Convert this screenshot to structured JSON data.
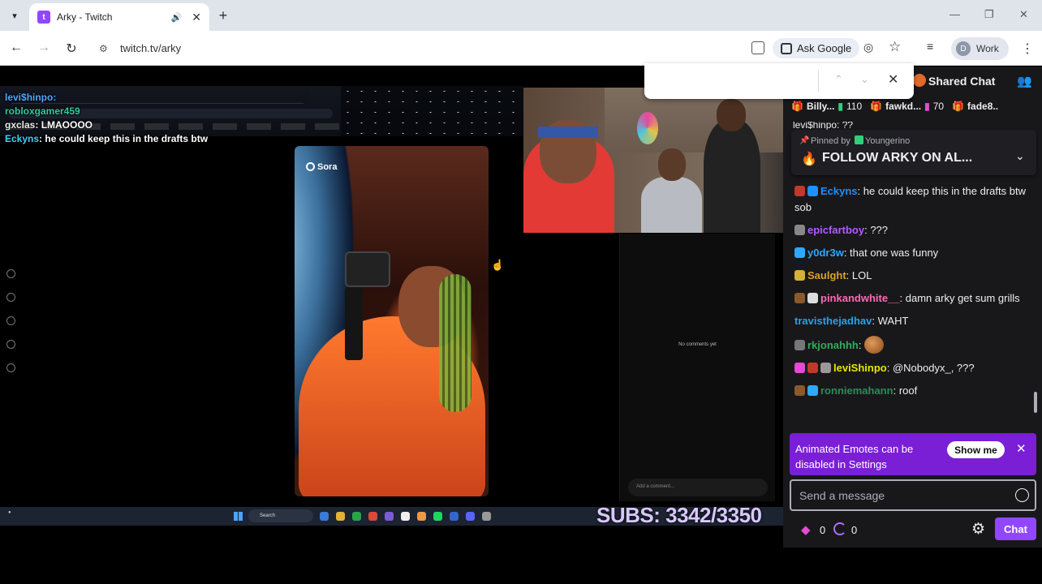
{
  "browser": {
    "tab_title": "Arky - Twitch",
    "url": "twitch.tv/arky",
    "ask_google": "Ask Google",
    "profile_initial": "D",
    "profile_name": "Work"
  },
  "stream": {
    "overlay_chat": [
      {
        "user": "levi$hinpo:",
        "text": ""
      },
      {
        "user": "robloxgamer459",
        "text": ""
      },
      {
        "user": "gxclas",
        "text": ": LMAOOOO"
      },
      {
        "user": "Eckyns",
        "text": ": he could keep this in the drafts btw"
      }
    ],
    "sora_label": "Sora",
    "no_comments": "No comments yet",
    "add_comment": "Add a comment...",
    "taskbar_search": "Search",
    "subs_text": "SUBS: 3342/3350"
  },
  "chat": {
    "shared_chat_label": "Shared Chat",
    "leaderboard": [
      {
        "name": "Billy...",
        "count": "110"
      },
      {
        "name": "fawkd...",
        "count": "70"
      },
      {
        "name": "fade8..",
        "count": ""
      }
    ],
    "top_clip": "levi$hinpo: ??",
    "pinned": {
      "by_prefix": "Pinned by",
      "by_user": "Youngerino",
      "message": "FOLLOW ARKY ON AL..."
    },
    "messages": [
      {
        "user": "Eckyns",
        "sep": ":",
        "text": " he could keep this in the drafts btw sob"
      },
      {
        "user": "epicfartboy",
        "sep": ":",
        "text": " ???"
      },
      {
        "user": "y0dr3w",
        "sep": ":",
        "text": " that one was funny"
      },
      {
        "user": "Saulght",
        "sep": ":",
        "text": " LOL"
      },
      {
        "user": "pinkandwhite__",
        "sep": ":",
        "text": " damn arky get sum grills"
      },
      {
        "user": "travisthejadhav",
        "sep": ":",
        "text": " WAHT"
      },
      {
        "user": "rkjonahhh",
        "sep": ":",
        "text": ""
      },
      {
        "user": "leviShinpo",
        "sep": ":",
        "text": " @Nobodyx_, ???"
      },
      {
        "user": "ronniemahann",
        "sep": ":",
        "text": " roof"
      }
    ],
    "banner": {
      "text": "Animated Emotes can be disabled in Settings",
      "button": "Show me"
    },
    "send_placeholder": "Send a message",
    "bits": "0",
    "points": "0",
    "chat_button": "Chat"
  }
}
